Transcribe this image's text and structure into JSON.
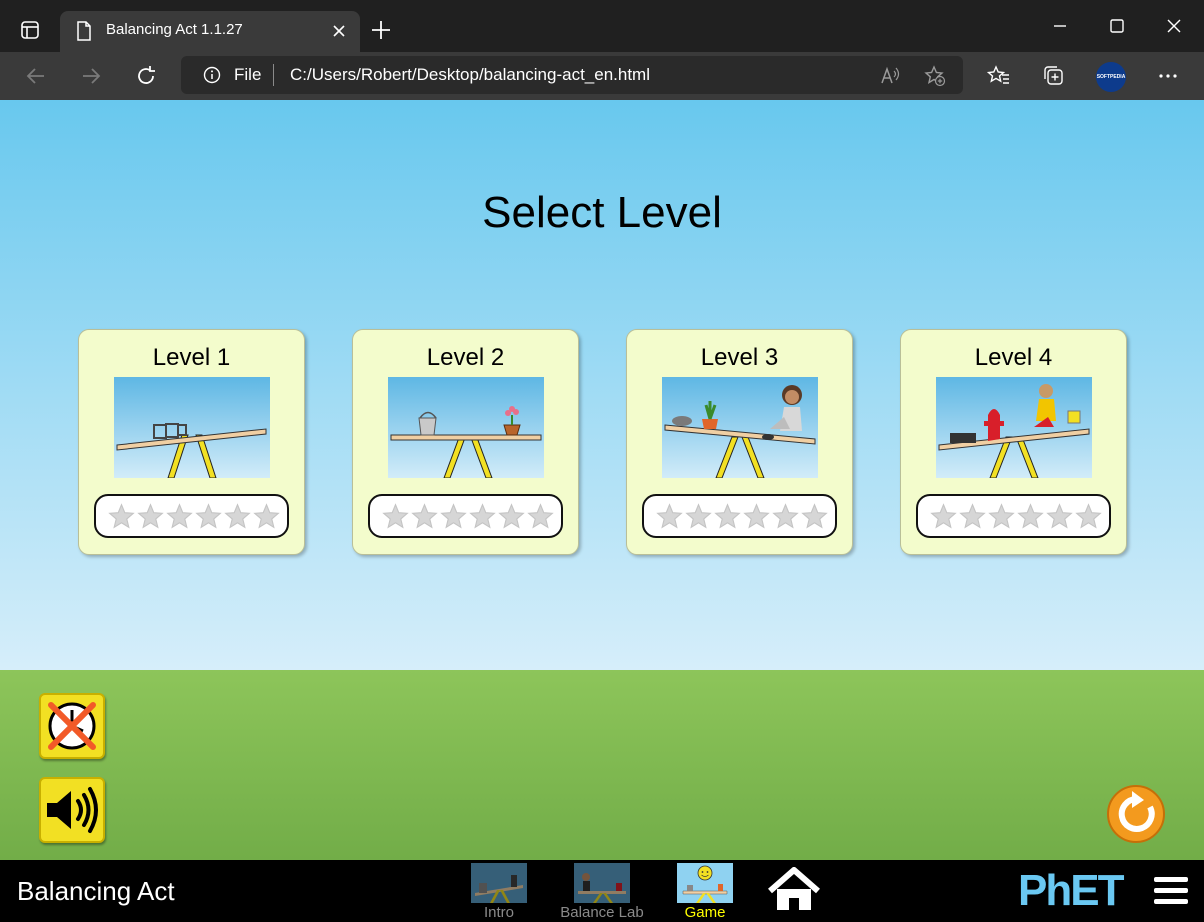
{
  "browser": {
    "tab_title": "Balancing Act 1.1.27",
    "scheme": "File",
    "url": "C:/Users/Robert/Desktop/balancing-act_en.html",
    "profile_badge": "SOFTPEDIA"
  },
  "app": {
    "heading": "Select Level",
    "levels": [
      {
        "label": "Level 1",
        "stars": 0,
        "max_stars": 6
      },
      {
        "label": "Level 2",
        "stars": 0,
        "max_stars": 6
      },
      {
        "label": "Level 3",
        "stars": 0,
        "max_stars": 6
      },
      {
        "label": "Level 4",
        "stars": 0,
        "max_stars": 6
      }
    ],
    "timer_enabled": false,
    "sound_enabled": true,
    "colors": {
      "accent_yellow": "#f2e023",
      "selected_screen": "#ffff00",
      "reset_orange": "#f39a1e"
    }
  },
  "navbar": {
    "app_name": "Balancing Act",
    "screens": [
      {
        "label": "Intro",
        "selected": false
      },
      {
        "label": "Balance Lab",
        "selected": false
      },
      {
        "label": "Game",
        "selected": true
      }
    ],
    "brand": "PhET"
  }
}
